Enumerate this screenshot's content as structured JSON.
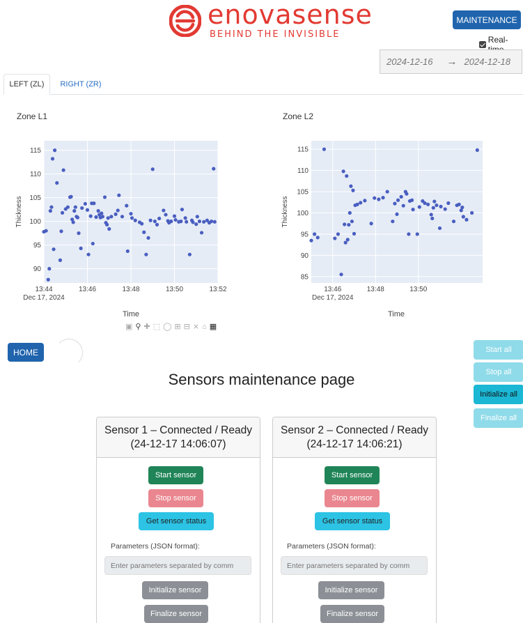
{
  "brand": {
    "name": "enovasense",
    "tagline": "BEHIND THE INVISIBLE",
    "color": "#e23a33"
  },
  "header": {
    "maintenance_label": "MAINTENANCE",
    "realtime_label": "Real-time",
    "realtime_checked": true,
    "date_start": "2024-12-16",
    "date_arrow": "→",
    "date_end": "2024-12-18"
  },
  "tabs": [
    {
      "label": "LEFT (ZL)",
      "active": true
    },
    {
      "label": "RIGHT (ZR)",
      "active": false
    }
  ],
  "chart_data": [
    {
      "type": "scatter",
      "title": "Zone L1",
      "xlabel": "Time",
      "ylabel": "Thickness",
      "x_range_minutes": [
        0,
        8
      ],
      "xticks": [
        "13:44",
        "13:46",
        "13:48",
        "13:50",
        "13:52"
      ],
      "xtick_subtitle": "Dec 17, 2024",
      "ylim": [
        87,
        117
      ],
      "yticks": [
        90,
        95,
        100,
        105,
        110,
        115
      ],
      "color": "#4a5ec0",
      "x": [
        0.0,
        0.1,
        0.2,
        0.25,
        0.3,
        0.35,
        0.4,
        0.45,
        0.5,
        0.6,
        0.75,
        0.8,
        0.85,
        0.9,
        1.0,
        1.1,
        1.2,
        1.25,
        1.3,
        1.35,
        1.4,
        1.45,
        1.5,
        1.55,
        1.6,
        1.7,
        1.75,
        1.9,
        2.0,
        2.05,
        2.15,
        2.2,
        2.25,
        2.3,
        2.4,
        2.5,
        2.55,
        2.6,
        2.65,
        2.7,
        2.8,
        2.85,
        2.9,
        2.95,
        3.0,
        3.1,
        3.3,
        3.4,
        3.45,
        3.6,
        3.8,
        3.85,
        4.0,
        4.05,
        4.2,
        4.4,
        4.5,
        4.6,
        4.7,
        4.8,
        4.9,
        5.0,
        5.1,
        5.2,
        5.3,
        5.5,
        5.6,
        5.7,
        5.75,
        5.85,
        6.0,
        6.05,
        6.2,
        6.3,
        6.35,
        6.5,
        6.55,
        6.7,
        6.8,
        6.85,
        7.0,
        7.05,
        7.15,
        7.25,
        7.35,
        7.5,
        7.6,
        7.7,
        7.8,
        7.85
      ],
      "y": [
        97.8,
        98.0,
        87.7,
        90.0,
        102.2,
        103.0,
        113.2,
        94.1,
        115.0,
        108.1,
        91.8,
        97.9,
        101.8,
        110.8,
        102.6,
        103.0,
        105.1,
        105.2,
        100.4,
        99.8,
        102.2,
        103.0,
        101.0,
        100.8,
        97.5,
        94.3,
        102.8,
        103.7,
        102.4,
        93.0,
        101.1,
        103.8,
        95.3,
        103.8,
        100.9,
        102.2,
        101.4,
        100.8,
        101.7,
        101.0,
        105.1,
        99.7,
        99.3,
        100.7,
        98.4,
        101.0,
        101.5,
        102.3,
        105.5,
        101.0,
        103.3,
        93.7,
        101.6,
        100.7,
        100.2,
        99.8,
        99.5,
        97.7,
        93.0,
        96.5,
        100.2,
        111.0,
        100.0,
        99.3,
        100.6,
        102.3,
        101.4,
        100.1,
        99.7,
        100.0,
        101.1,
        100.3,
        99.9,
        100.0,
        102.5,
        100.7,
        99.9,
        93.0,
        100.2,
        99.8,
        99.4,
        101.0,
        100.0,
        97.6,
        99.9,
        100.2,
        99.7,
        100.0,
        111.1,
        99.9
      ]
    },
    {
      "type": "scatter",
      "title": "Zone L2",
      "xlabel": "Time",
      "ylabel": "Thickness",
      "x_range_minutes": [
        0,
        8
      ],
      "xticks": [
        "13:46",
        "13:48",
        "13:50"
      ],
      "xtick_subtitle": "Dec 17, 2024",
      "ylim": [
        83.5,
        117
      ],
      "yticks": [
        85,
        90,
        95,
        100,
        105,
        110,
        115
      ],
      "color": "#4a5ec0",
      "x": [
        0.0,
        0.15,
        0.3,
        0.6,
        1.1,
        1.25,
        1.4,
        1.5,
        1.55,
        1.6,
        1.65,
        1.7,
        1.75,
        1.8,
        1.85,
        1.9,
        1.95,
        2.0,
        2.05,
        2.15,
        2.3,
        2.5,
        2.8,
        2.95,
        3.15,
        3.35,
        3.55,
        3.8,
        3.9,
        4.0,
        4.05,
        4.2,
        4.3,
        4.4,
        4.45,
        4.55,
        4.6,
        4.7,
        4.75,
        4.95,
        5.05,
        5.2,
        5.3,
        5.45,
        5.6,
        5.65,
        5.7,
        5.75,
        5.85,
        6.0,
        6.05,
        6.25,
        6.4,
        6.65,
        6.8,
        6.9,
        7.0,
        7.05,
        7.1,
        7.25,
        7.5,
        7.75
      ],
      "y": [
        93.5,
        95.0,
        94.2,
        115.0,
        94.0,
        95.0,
        85.5,
        109.8,
        97.3,
        93.0,
        108.7,
        93.7,
        97.2,
        100.0,
        106.3,
        98.0,
        105.3,
        95.1,
        101.8,
        102.0,
        102.4,
        102.9,
        97.5,
        103.5,
        103.2,
        103.6,
        105.0,
        98.0,
        102.2,
        99.7,
        103.0,
        103.8,
        101.7,
        105.0,
        104.5,
        95.0,
        102.8,
        103.0,
        100.8,
        95.0,
        101.4,
        102.8,
        102.3,
        102.0,
        99.6,
        98.7,
        101.2,
        102.7,
        101.8,
        96.4,
        101.5,
        100.9,
        102.3,
        98.0,
        101.8,
        102.0,
        100.6,
        101.3,
        99.1,
        98.4,
        100.0,
        114.8
      ]
    }
  ],
  "modebar": {
    "icons": [
      "camera-icon",
      "zoom-icon",
      "pan-icon",
      "box-select-icon",
      "lasso-icon",
      "zoom-in-icon",
      "zoom-out-icon",
      "autoscale-icon",
      "home-icon",
      "plotly-logo-icon"
    ]
  },
  "maintenance": {
    "home_label": "HOME",
    "heading": "Sensors maintenance page",
    "side_buttons": {
      "start_all": "Start all",
      "stop_all": "Stop all",
      "initialize_all": "Initialize all",
      "finalize_all": "Finalize all"
    },
    "sensors": [
      {
        "title": "Sensor 1 – Connected / Ready (24-12-17 14:06:07)",
        "start_label": "Start sensor",
        "stop_label": "Stop sensor",
        "status_label": "Get sensor status",
        "params_label": "Parameters (JSON format):",
        "params_placeholder": "Enter parameters separated by comm",
        "init_label": "Initialize sensor",
        "final_label": "Finalize sensor"
      },
      {
        "title": "Sensor 2 – Connected / Ready (24-12-17 14:06:21)",
        "start_label": "Start sensor",
        "stop_label": "Stop sensor",
        "status_label": "Get sensor status",
        "params_label": "Parameters (JSON format):",
        "params_placeholder": "Enter parameters separated by comm",
        "init_label": "Initialize sensor",
        "final_label": "Finalize sensor"
      }
    ]
  }
}
